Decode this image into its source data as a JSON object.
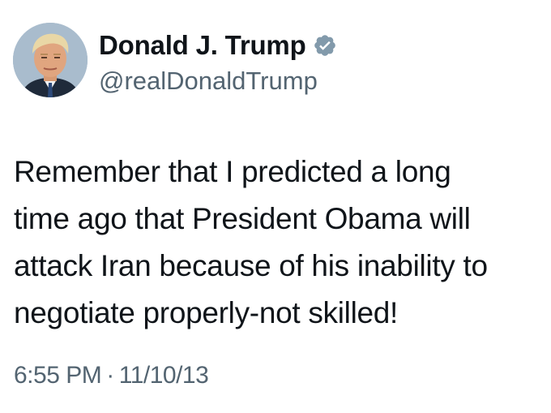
{
  "author": {
    "display_name": "Donald J. Trump",
    "handle": "@realDonaldTrump",
    "verified": true,
    "verified_badge_icon": "verified-badge-icon",
    "avatar_icon": "profile-photo",
    "verified_color": "#829aab"
  },
  "tweet": {
    "text_lines": [
      "Remember that I predicted a long",
      "time ago that President Obama will",
      "attack Iran because of his inability to",
      "negotiate properly-not skilled!"
    ],
    "time": "6:55 PM",
    "separator": "·",
    "date": "11/10/13"
  },
  "colors": {
    "text_primary": "#0f1419",
    "text_secondary": "#536471",
    "background": "#ffffff"
  }
}
